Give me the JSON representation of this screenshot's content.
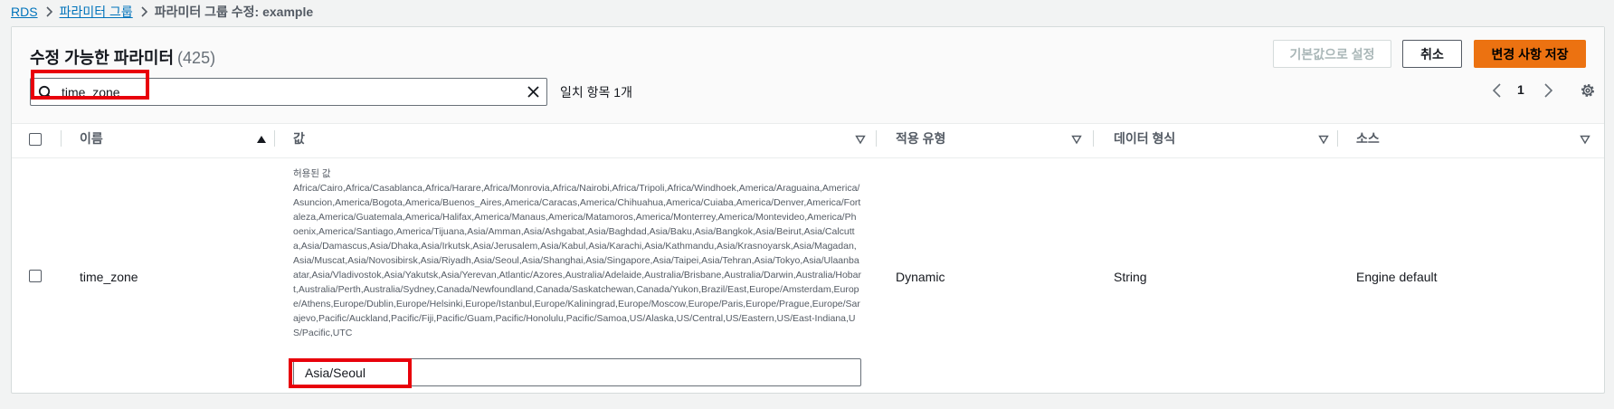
{
  "breadcrumb": {
    "items": [
      "RDS",
      "파라미터 그룹"
    ],
    "current": "파라미터 그룹 수정: example"
  },
  "panel": {
    "title": "수정 가능한 파라미터",
    "count": "(425)",
    "buttons": {
      "reset_default": "기본값으로 설정",
      "cancel": "취소",
      "save": "변경 사항 저장"
    }
  },
  "search": {
    "value": "time_zone",
    "match_count": "일치 항목 1개"
  },
  "pagination": {
    "current_page": "1"
  },
  "table": {
    "columns": [
      "이름",
      "값",
      "적용 유형",
      "데이터 형식",
      "소스"
    ],
    "rows": [
      {
        "name": "time_zone",
        "allowed_label": "허용된 값",
        "allowed_values": "Africa/Cairo,Africa/Casablanca,Africa/Harare,Africa/Monrovia,Africa/Nairobi,Africa/Tripoli,Africa/Windhoek,America/Araguaina,America/Asuncion,America/Bogota,America/Buenos_Aires,America/Caracas,America/Chihuahua,America/Cuiaba,America/Denver,America/Fortaleza,America/Guatemala,America/Halifax,America/Manaus,America/Matamoros,America/Monterrey,America/Montevideo,America/Phoenix,America/Santiago,America/Tijuana,Asia/Amman,Asia/Ashgabat,Asia/Baghdad,Asia/Baku,Asia/Bangkok,Asia/Beirut,Asia/Calcutta,Asia/Damascus,Asia/Dhaka,Asia/Irkutsk,Asia/Jerusalem,Asia/Kabul,Asia/Karachi,Asia/Kathmandu,Asia/Krasnoyarsk,Asia/Magadan,Asia/Muscat,Asia/Novosibirsk,Asia/Riyadh,Asia/Seoul,Asia/Shanghai,Asia/Singapore,Asia/Taipei,Asia/Tehran,Asia/Tokyo,Asia/Ulaanbaatar,Asia/Vladivostok,Asia/Yakutsk,Asia/Yerevan,Atlantic/Azores,Australia/Adelaide,Australia/Brisbane,Australia/Darwin,Australia/Hobart,Australia/Perth,Australia/Sydney,Canada/Newfoundland,Canada/Saskatchewan,Canada/Yukon,Brazil/East,Europe/Amsterdam,Europe/Athens,Europe/Dublin,Europe/Helsinki,Europe/Istanbul,Europe/Kaliningrad,Europe/Moscow,Europe/Paris,Europe/Prague,Europe/Sarajevo,Pacific/Auckland,Pacific/Fiji,Pacific/Guam,Pacific/Honolulu,Pacific/Samoa,US/Alaska,US/Central,US/Eastern,US/East-Indiana,US/Pacific,UTC",
        "value": "Asia/Seoul",
        "apply_type": "Dynamic",
        "data_type": "String",
        "source": "Engine default"
      }
    ]
  },
  "colors": {
    "accent": "#ec7211",
    "link": "#0073bb",
    "highlight": "#e8000b"
  },
  "icons": [
    "search-icon",
    "close-icon",
    "chevron-left-icon",
    "chevron-right-icon",
    "gear-icon",
    "sort-ascending-icon",
    "sort-descending-icon"
  ]
}
